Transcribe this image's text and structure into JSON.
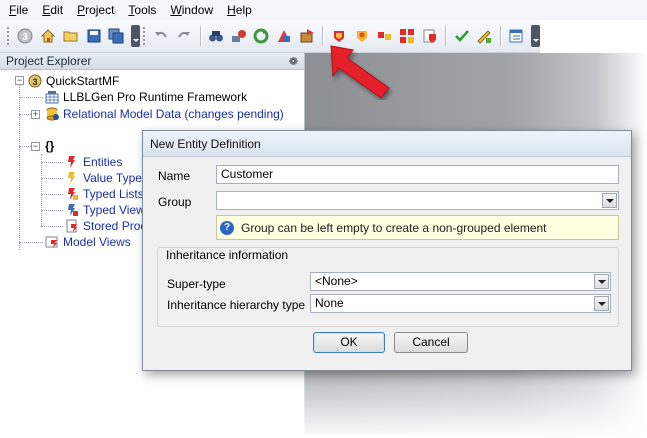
{
  "menu": [
    {
      "hotkey": "F",
      "rest": "ile"
    },
    {
      "hotkey": "E",
      "rest": "dit"
    },
    {
      "hotkey": "P",
      "rest": "roject"
    },
    {
      "hotkey": "T",
      "rest": "ools"
    },
    {
      "hotkey": "W",
      "rest": "indow"
    },
    {
      "hotkey": "H",
      "rest": "elp"
    }
  ],
  "explorer": {
    "title": "Project Explorer",
    "pin": "❁",
    "tree": {
      "project": "QuickStartMF",
      "framework": "LLBLGen Pro Runtime Framework",
      "relational": "Relational Model Data (changes pending)",
      "namespace": "{}",
      "entities": "Entities",
      "value_types": "Value Types",
      "typed_lists": "Typed Lists",
      "typed_views": "Typed Views",
      "stored_procs": "Stored Proce",
      "model_views": "Model Views"
    }
  },
  "dialog": {
    "title": "New Entity Definition",
    "name_label": "Name",
    "name_value": "Customer",
    "group_label": "Group",
    "group_value": "",
    "hint": "Group can be left empty to create a non-grouped element",
    "inheritance_legend": "Inheritance information",
    "supertype_label": "Super-type",
    "supertype_value": "<None>",
    "hierarchy_label": "Inheritance hierarchy type",
    "hierarchy_value": "None",
    "ok": "OK",
    "cancel": "Cancel"
  },
  "colors": {
    "accent": "#2b67c2",
    "arrow": "#e5202a"
  }
}
